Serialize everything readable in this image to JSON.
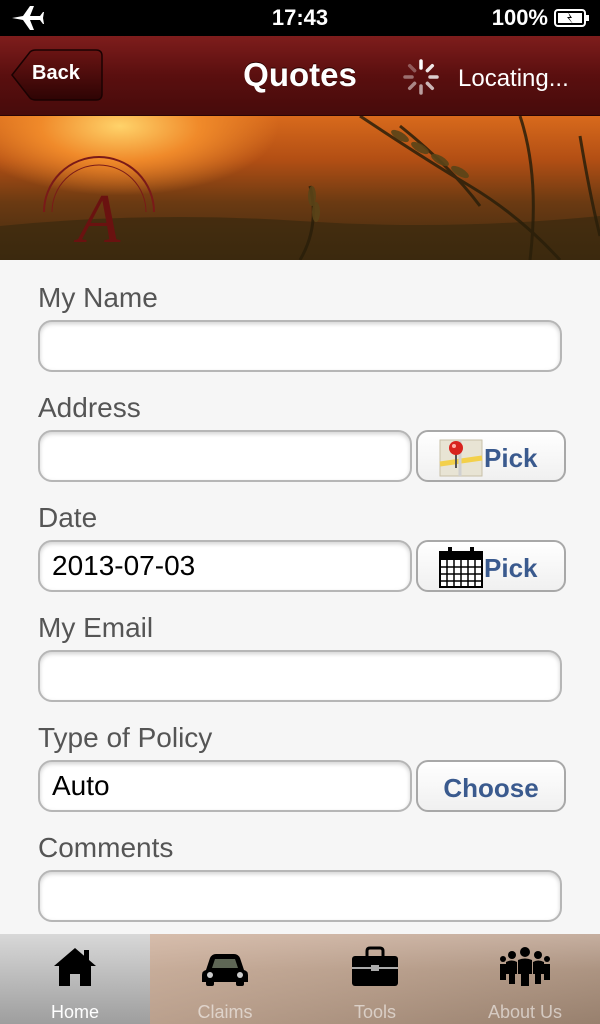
{
  "status_bar": {
    "time": "17:43",
    "battery": "100%"
  },
  "nav": {
    "back_label": "Back",
    "title": "Quotes",
    "status": "Locating..."
  },
  "form": {
    "name_label": "My Name",
    "name_value": "",
    "address_label": "Address",
    "address_value": "",
    "address_button": "Pick",
    "date_label": "Date",
    "date_value": "2013-07-03",
    "date_button": "Pick",
    "email_label": "My Email",
    "email_value": "",
    "policy_label": "Type of Policy",
    "policy_value": "Auto",
    "policy_button": "Choose",
    "comments_label": "Comments",
    "comments_value": ""
  },
  "tabs": [
    {
      "label": "Home",
      "icon": "home-icon",
      "active": true
    },
    {
      "label": "Claims",
      "icon": "car-icon",
      "active": false
    },
    {
      "label": "Tools",
      "icon": "toolbox-icon",
      "active": false
    },
    {
      "label": "About Us",
      "icon": "people-icon",
      "active": false
    }
  ],
  "colors": {
    "nav_bar": "#5a0f0f",
    "button_text": "#3a5a8e"
  }
}
